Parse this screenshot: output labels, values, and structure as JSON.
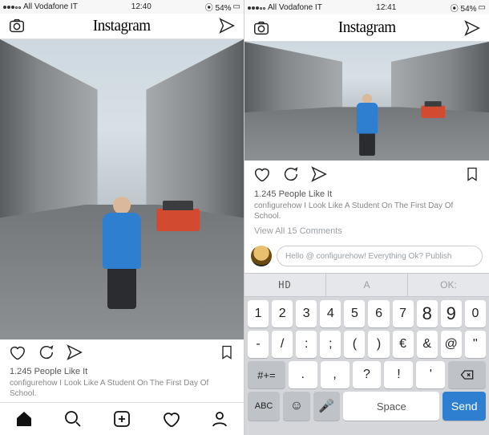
{
  "left": {
    "status": {
      "carrier": "All Vodafone IT",
      "time": "12:40",
      "battery": "54%"
    },
    "header": {
      "logo": "Instagram"
    },
    "likes": "1.245 People Like It",
    "caption": "configurehow I Look Like A Student On The First Day Of School."
  },
  "right": {
    "status": {
      "carrier": "All Vodafone IT",
      "time": "12:41",
      "battery": "54%"
    },
    "header": {
      "logo": "Instagram"
    },
    "likes": "1.245 People Like It",
    "caption": "configurehow I Look Like A Student On The First Day Of School.",
    "view_comments": "View All 15 Comments",
    "compose_placeholder": "Hello @ configurehow! Everything Ok? Publish",
    "predict": {
      "left": "HD",
      "mid": "A",
      "right": "OK:"
    },
    "keys_r1": [
      "1",
      "2",
      "3",
      "4",
      "5",
      "6",
      "7",
      "8",
      "9",
      "0"
    ],
    "keys_r2": [
      "-",
      "/",
      ":",
      ";",
      "(",
      ")",
      "€",
      "&",
      "@",
      "\""
    ],
    "keys_r3_shift": "#+=",
    "keys_r3": [
      ".",
      ",",
      "?",
      "!",
      "'"
    ],
    "keys_r4": {
      "abc": "ABC",
      "space": "Space",
      "send": "Send"
    }
  }
}
